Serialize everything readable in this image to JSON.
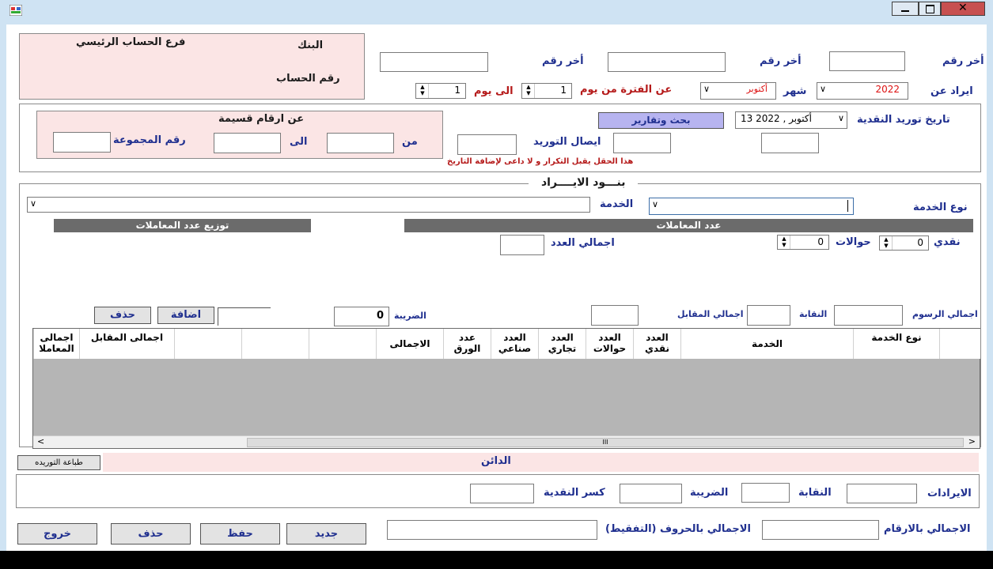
{
  "window": {
    "colors": {
      "title_bg": "#cfe3f3",
      "close": "#c75050"
    }
  },
  "bank_box": {
    "bank_label": "البنك",
    "branch_label": "فرع الحساب الرئيسي",
    "account_label": "رقم الحساب"
  },
  "header": {
    "last_num_1": "أخر رقم",
    "last_num_2": "أخر رقم",
    "last_num_3": "أخر رقم",
    "revenue_from": "ايراد عن",
    "year_value": "2022",
    "month_label": "شهر",
    "month_value": "أكتوبر",
    "period_from_day": "عن الفترة من يوم",
    "from_day_value": "1",
    "to_day": "الى يوم",
    "to_day_value": "1"
  },
  "supply": {
    "date_label": "تاريخ توريد النقدية",
    "date_value": "13   أكتوبر  , 2022",
    "search_button": "بحث وتقارير",
    "receipt_label": "ايصال التوريد",
    "note": "هذا الحقل يقبل التكرار و لا داعى لإضافة التاريخ"
  },
  "voucher": {
    "title": "عن ارقام قسيمة",
    "from": "من",
    "to": "الى",
    "group_num": "رقم المجموعة"
  },
  "items": {
    "section_title": "بنـــود الايــــراد",
    "service_type_label": "نوع الخدمة",
    "service_label": "الخدمة",
    "transactions_count_bar": "عدد المعاملات",
    "distribution_bar": "توزيع عدد المعاملات",
    "cash_label": "نقدي",
    "cash_value": "0",
    "transfers_label": "حوالات",
    "transfers_value": "0",
    "total_count_label": "اجمالي العدد",
    "total_fees_label": "اجمالي الرسوم",
    "syndicate_label": "النقابة",
    "total_cost_label": "اجمالي المقابل",
    "tax_label": "الضريبة",
    "tax_value": "0",
    "add_button": "اضافة",
    "delete_button": "حذف"
  },
  "grid": {
    "columns": [
      "نوع الخدمة",
      "الخدمة",
      "العدد نقدي",
      "العدد حوالات",
      "العدد تجاري",
      "العدد صناعي",
      "عدد الورق",
      "الاجمالى",
      "",
      "",
      "",
      "اجمالى المقابل",
      "اجمالى المعاملا"
    ],
    "scroll_mark": "III"
  },
  "footer": {
    "print_button": "طباعة التوريده",
    "creditor_title": "الدائن",
    "revenues_label": "الايرادات",
    "syndicate_label": "النقابة",
    "tax_label": "الضريبة",
    "cash_fraction_label": "كسر النقدية",
    "total_numbers_label": "الاجمالي بالارقام",
    "total_words_label": "الاجمالي بالحروف (التفقيط)",
    "new_button": "جديد",
    "save_button": "حفظ",
    "delete_button": "حذف",
    "exit_button": "خروج"
  }
}
